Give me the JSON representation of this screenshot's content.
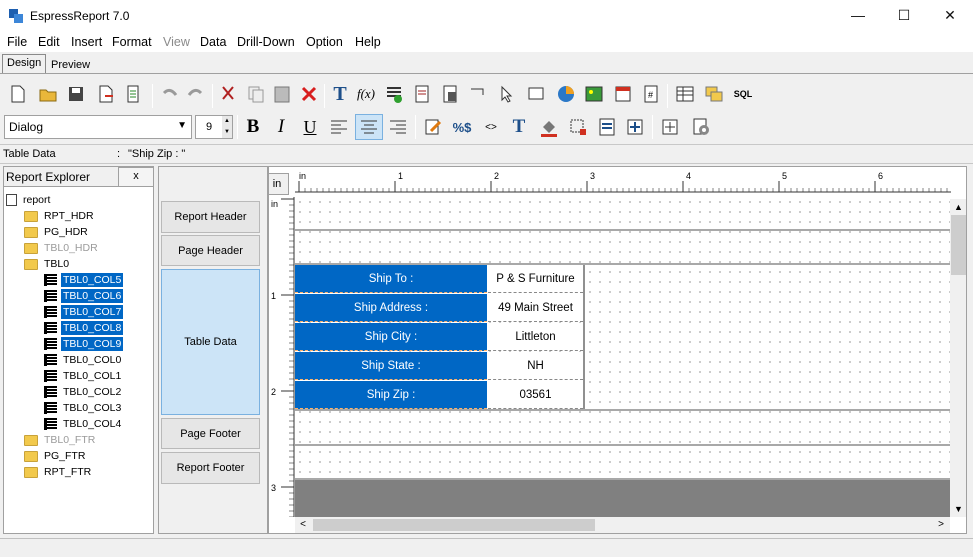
{
  "window": {
    "title": "EspressReport 7.0",
    "minimize": "—",
    "maximize": "☐",
    "close": "✕"
  },
  "menu": [
    "File",
    "Edit",
    "Insert",
    "Format",
    "View",
    "Data",
    "Drill-Down",
    "Option",
    "Help"
  ],
  "tabs": {
    "design": "Design",
    "preview": "Preview"
  },
  "format": {
    "font": "Dialog",
    "size": "9"
  },
  "property": {
    "label": "Table Data",
    "value": "\"Ship Zip : \""
  },
  "explorer": {
    "title": "Report Explorer",
    "close": "x",
    "root": "report",
    "nodes": [
      {
        "label": "RPT_HDR",
        "type": "folder",
        "state": "normal"
      },
      {
        "label": "PG_HDR",
        "type": "folder",
        "state": "normal"
      },
      {
        "label": "TBL0_HDR",
        "type": "folder",
        "state": "dim"
      },
      {
        "label": "TBL0",
        "type": "folder",
        "state": "normal"
      },
      {
        "label": "TBL0_COL5",
        "type": "col",
        "state": "sel"
      },
      {
        "label": "TBL0_COL6",
        "type": "col",
        "state": "sel"
      },
      {
        "label": "TBL0_COL7",
        "type": "col",
        "state": "sel"
      },
      {
        "label": "TBL0_COL8",
        "type": "col",
        "state": "sel"
      },
      {
        "label": "TBL0_COL9",
        "type": "col",
        "state": "sel"
      },
      {
        "label": "TBL0_COL0",
        "type": "col",
        "state": "normal"
      },
      {
        "label": "TBL0_COL1",
        "type": "col",
        "state": "normal"
      },
      {
        "label": "TBL0_COL2",
        "type": "col",
        "state": "normal"
      },
      {
        "label": "TBL0_COL3",
        "type": "col",
        "state": "normal"
      },
      {
        "label": "TBL0_COL4",
        "type": "col",
        "state": "normal"
      },
      {
        "label": "TBL0_FTR",
        "type": "folder",
        "state": "dim"
      },
      {
        "label": "PG_FTR",
        "type": "folder",
        "state": "normal"
      },
      {
        "label": "RPT_FTR",
        "type": "folder",
        "state": "normal"
      }
    ]
  },
  "sections": [
    "Report Header",
    "Page Header",
    "Table Data",
    "Page Footer",
    "Report Footer"
  ],
  "ruler": {
    "unit": "in",
    "h_marks": [
      "in",
      "1",
      "2",
      "3",
      "4",
      "5",
      "6"
    ],
    "v_marks": [
      "in",
      "1",
      "2",
      "3"
    ]
  },
  "table": {
    "labels": [
      "Ship To :",
      "Ship Address :",
      "Ship City :",
      "Ship State :",
      "Ship Zip :"
    ],
    "values": [
      "P & S Furniture",
      "49 Main Street",
      "Littleton",
      "NH",
      "03561"
    ]
  },
  "colors": {
    "selection": "#0067c5",
    "footer_band": "#808080"
  }
}
